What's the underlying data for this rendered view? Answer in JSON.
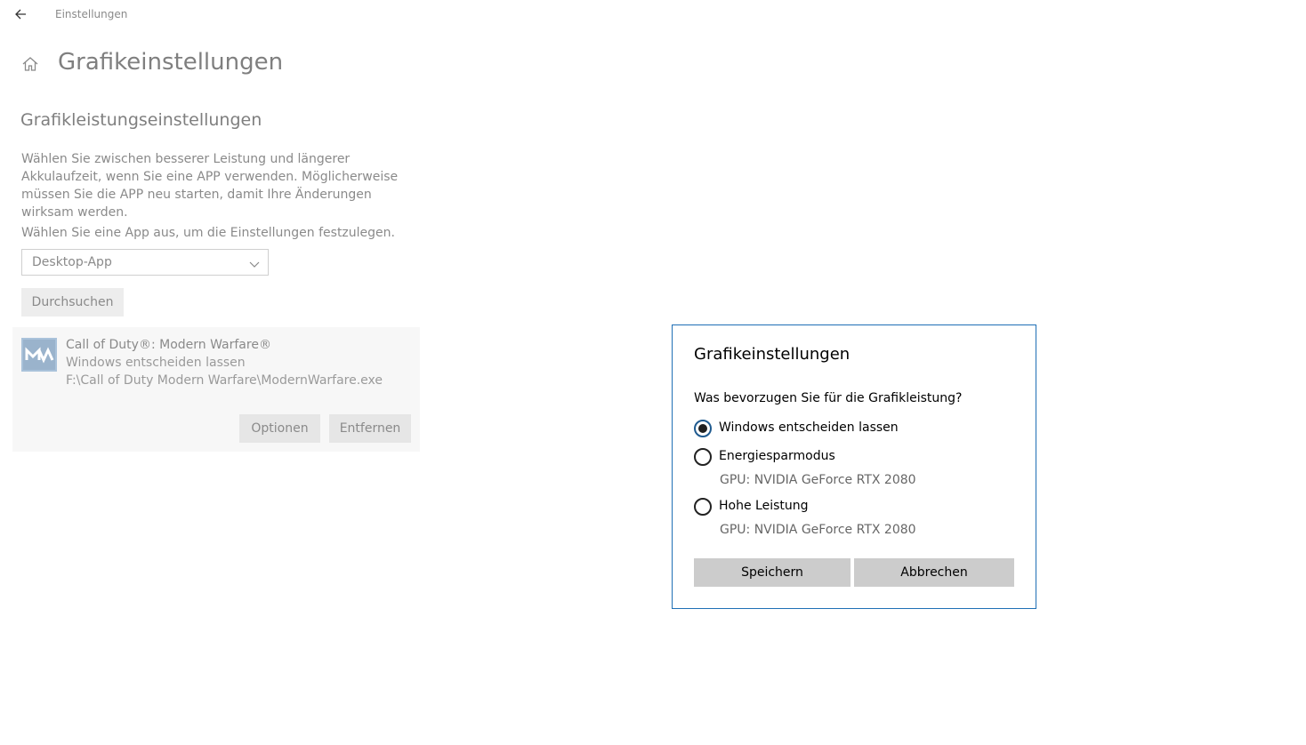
{
  "window": {
    "title": "Einstellungen"
  },
  "page": {
    "title": "Grafikeinstellungen",
    "section_title": "Grafikleistungseinstellungen",
    "description": "Wählen Sie zwischen besserer Leistung und längerer Akkulaufzeit, wenn Sie eine APP verwenden. Möglicherweise müssen Sie die APP neu starten, damit Ihre Änderungen wirksam werden.",
    "choose_label": "Wählen Sie eine App aus, um die Einstellungen festzulegen.",
    "app_type_selected": "Desktop-App",
    "browse_label": "Durchsuchen"
  },
  "app_card": {
    "name": "Call of Duty®: Modern Warfare®",
    "preference": "Windows entscheiden lassen",
    "path": "F:\\Call of Duty Modern Warfare\\ModernWarfare.exe",
    "options_label": "Optionen",
    "remove_label": "Entfernen",
    "icon_letters": "MW"
  },
  "dialog": {
    "title": "Grafikeinstellungen",
    "question": "Was bevorzugen Sie für die Grafikleistung?",
    "options": [
      {
        "label": "Windows entscheiden lassen",
        "sub": "",
        "checked": true
      },
      {
        "label": "Energiesparmodus",
        "sub": "GPU: NVIDIA GeForce RTX 2080",
        "checked": false
      },
      {
        "label": "Hohe Leistung",
        "sub": "GPU: NVIDIA GeForce RTX 2080",
        "checked": false
      }
    ],
    "save_label": "Speichern",
    "cancel_label": "Abbrechen"
  },
  "colors": {
    "accent": "#1f6fb5",
    "button_gray": "#cccccc",
    "dim_text": "#8a8a8a"
  }
}
